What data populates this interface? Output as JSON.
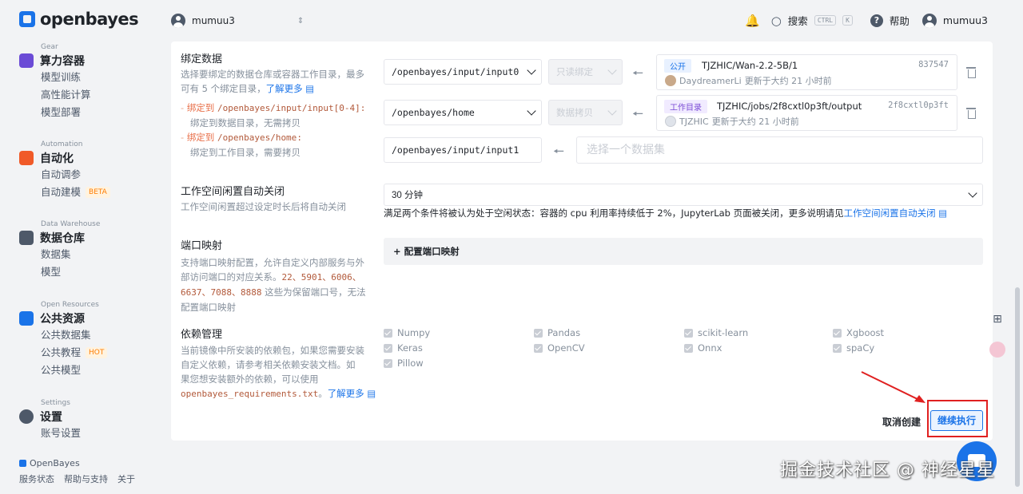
{
  "header": {
    "brand": "openbayes",
    "username": "mumuu3",
    "search_label": "搜索",
    "kbd_ctrl": "CTRL",
    "kbd_k": "K",
    "help_label": "帮助",
    "help_glyph": "?",
    "account_name": "mumuu3"
  },
  "sidebar": {
    "groups": [
      {
        "category": "Gear",
        "title": "算力容器",
        "items": [
          "模型训练",
          "高性能计算",
          "模型部署"
        ]
      },
      {
        "category": "Automation",
        "title": "自动化",
        "items": [
          "自动调参",
          "自动建模"
        ],
        "badge": "BETA"
      },
      {
        "category": "Data Warehouse",
        "title": "数据仓库",
        "items": [
          "数据集",
          "模型"
        ]
      },
      {
        "category": "Open Resources",
        "title": "公共资源",
        "items": [
          "公共数据集",
          "公共教程",
          "公共模型"
        ],
        "badge": "HOT"
      },
      {
        "category": "Settings",
        "title": "设置",
        "items": [
          "账号设置"
        ]
      }
    ],
    "footer_brand": "OpenBayes",
    "footer_links": [
      "服务状态",
      "帮助与支持",
      "关于"
    ]
  },
  "bind_data": {
    "title": "绑定数据",
    "desc_1": "选择要绑定的数据仓库或容器工作目录，最多",
    "desc_2": "可有 5 个绑定目录，",
    "learn_more": "了解更多",
    "tree_1_prefix": "绑定到 ",
    "tree_1_path": "/openbayes/input/input[0-4]",
    "tree_1_suffix": ":",
    "tree_1_note": "绑定到数据目录，无需拷贝",
    "tree_2_prefix": "绑定到 ",
    "tree_2_path": "/openbayes/home",
    "tree_2_suffix": ":",
    "tree_2_note": "绑定到工作目录，需要拷贝",
    "rows": [
      {
        "path": "/openbayes/input/input0",
        "mode": "只读绑定",
        "tag": "公开",
        "name": "TJZHIC/Wan-2.2-5B/1",
        "hash": "837547",
        "user": "DaydreamerLi",
        "updated": "更新于大约 21 小时前"
      },
      {
        "path": "/openbayes/home",
        "mode": "数据拷贝",
        "tag": "工作目录",
        "name": "TJZHIC/jobs/2f8cxtl0p3ft/output",
        "hash": "2f8cxtl0p3ft",
        "user": "TJZHIC",
        "updated": "更新于大约 21 小时前"
      }
    ],
    "empty_row_path": "/openbayes/input/input1",
    "empty_placeholder": "选择一个数据集",
    "arrow_glyph": "🠔"
  },
  "idle": {
    "title": "工作空间闲置自动关闭",
    "desc": "工作空间闲置超过设定时长后将自动关闭",
    "value": "30 分钟",
    "hint_prefix": "满足两个条件将被认为处于空闲状态：容器的 cpu 利用率持续低于 2%，JupyterLab 页面被关闭，更多说明请见",
    "hint_link": "工作空间闲置自动关闭"
  },
  "ports": {
    "title": "端口映射",
    "desc_1": "支持端口映射配置，允许自定义内部服务与外",
    "desc_2": "部访问端口的对应关系。",
    "desc_ports_a": "22、5901、6006、",
    "desc_ports_b": "6637、7088、8888",
    "desc_3": " 这些为保留端口号，无法",
    "desc_4": "配置端口映射",
    "button": "+ 配置端口映射"
  },
  "deps": {
    "title": "依赖管理",
    "desc_1": "当前镜像中所安装的依赖包，如果您需要安装",
    "desc_2": "自定义依赖，请参考相关依赖安装文档。如",
    "desc_3": "果您想安装额外的依赖，可以使用",
    "desc_file": "openbayes_requirements.txt",
    "desc_4": "。",
    "learn_more": "了解更多",
    "packages": [
      "Numpy",
      "Pandas",
      "scikit-learn",
      "Xgboost",
      "Keras",
      "OpenCV",
      "Onnx",
      "spaCy",
      "Pillow"
    ]
  },
  "actions": {
    "cancel": "取消创建",
    "continue": "继续执行"
  },
  "watermark": "掘金技术社区 @ 神经星星",
  "colors": {
    "accent": "#1a73e8",
    "highlight": "#e02020",
    "mono_text": "#b2593a"
  }
}
